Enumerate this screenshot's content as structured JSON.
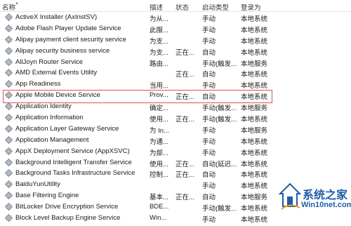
{
  "columns": {
    "name": "名称",
    "description": "描述",
    "status": "状态",
    "startup_type": "启动类型",
    "logon_as": "登录为"
  },
  "services": [
    {
      "name": "ActiveX Installer (AxInstSV)",
      "description": "为从...",
      "status": "",
      "startup_type": "手动",
      "logon_as": "本地系统"
    },
    {
      "name": "Adobe Flash Player Update Service",
      "description": "此服...",
      "status": "",
      "startup_type": "手动",
      "logon_as": "本地系统"
    },
    {
      "name": "Alipay payment client security service",
      "description": "为支...",
      "status": "",
      "startup_type": "手动",
      "logon_as": "本地系统"
    },
    {
      "name": "Alipay security business service",
      "description": "为支...",
      "status": "正在...",
      "startup_type": "自动",
      "logon_as": "本地系统"
    },
    {
      "name": "AllJoyn Router Service",
      "description": "路由...",
      "status": "",
      "startup_type": "手动(触发...",
      "logon_as": "本地服务"
    },
    {
      "name": "AMD External Events Utility",
      "description": "",
      "status": "正在...",
      "startup_type": "自动",
      "logon_as": "本地系统"
    },
    {
      "name": "App Readiness",
      "description": "当用...",
      "status": "",
      "startup_type": "手动",
      "logon_as": "本地系统"
    },
    {
      "name": "Apple Mobile Device Service",
      "description": "Prov...",
      "status": "正在...",
      "startup_type": "自动",
      "logon_as": "本地系统"
    },
    {
      "name": "Application Identity",
      "description": "确定...",
      "status": "",
      "startup_type": "手动(触发...",
      "logon_as": "本地服务"
    },
    {
      "name": "Application Information",
      "description": "使用...",
      "status": "正在...",
      "startup_type": "手动(触发...",
      "logon_as": "本地系统"
    },
    {
      "name": "Application Layer Gateway Service",
      "description": "为 In...",
      "status": "",
      "startup_type": "手动",
      "logon_as": "本地服务"
    },
    {
      "name": "Application Management",
      "description": "为通...",
      "status": "",
      "startup_type": "手动",
      "logon_as": "本地系统"
    },
    {
      "name": "AppX Deployment Service (AppXSVC)",
      "description": "为部...",
      "status": "",
      "startup_type": "手动",
      "logon_as": "本地系统"
    },
    {
      "name": "Background Intelligent Transfer Service",
      "description": "使用...",
      "status": "正在...",
      "startup_type": "自动(延迟...",
      "logon_as": "本地系统"
    },
    {
      "name": "Background Tasks Infrastructure Service",
      "description": "控制...",
      "status": "正在...",
      "startup_type": "自动",
      "logon_as": "本地系统"
    },
    {
      "name": "BaiduYunUtility",
      "description": "",
      "status": "",
      "startup_type": "手动",
      "logon_as": "本地系统"
    },
    {
      "name": "Base Filtering Engine",
      "description": "基本...",
      "status": "正在...",
      "startup_type": "自动",
      "logon_as": "本地服务"
    },
    {
      "name": "BitLocker Drive Encryption Service",
      "description": "BDE...",
      "status": "",
      "startup_type": "手动(触发...",
      "logon_as": "本地系统"
    },
    {
      "name": "Block Level Backup Engine Service",
      "description": "Win...",
      "status": "",
      "startup_type": "手动",
      "logon_as": "本地系统"
    }
  ],
  "highlighted_row": 7,
  "watermark": {
    "title": "系统之家",
    "subtitle": "Win10net.com"
  },
  "colors": {
    "highlight_border": "#d9534f",
    "watermark_blue": "#1e5ea8"
  }
}
